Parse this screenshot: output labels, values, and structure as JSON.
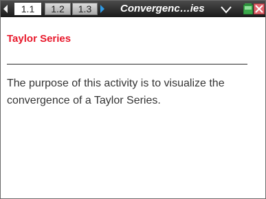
{
  "titlebar": {
    "tabs": [
      {
        "label": "1.1",
        "active": true
      },
      {
        "label": "1.2",
        "active": false
      },
      {
        "label": "1.3",
        "active": false
      }
    ],
    "document_title": "Convergenc…ies",
    "icons": {
      "nav_left": "triangle-left-icon",
      "nav_right": "triangle-right-icon",
      "doc_menu": "chevron-down-icon",
      "battery": "battery-icon",
      "close": "close-icon"
    }
  },
  "page": {
    "heading": "Taylor Series",
    "body": "The purpose of this activity is to visualize the convergence of a Taylor Series."
  },
  "colors": {
    "heading": "#e8182b",
    "accent_arrow": "#2f9be6",
    "battery_green": "#3aa84a",
    "close_red": "#e0656d"
  }
}
